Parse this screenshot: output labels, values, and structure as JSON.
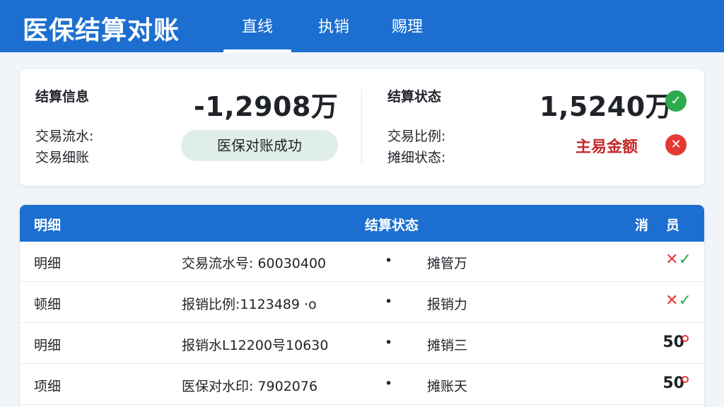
{
  "header": {
    "title": "医保结算对账",
    "tabs": [
      {
        "label": "直线",
        "active": true
      },
      {
        "label": "执销",
        "active": false
      },
      {
        "label": "赐理",
        "active": false
      }
    ]
  },
  "summary": {
    "left": {
      "heading": "结算信息",
      "amount": "-1,2908万",
      "line1": "交易流水:",
      "line2": "交易细账",
      "pill": "医保对账成功"
    },
    "right": {
      "heading": "结算状态",
      "amount": "1,5240万",
      "line1": "交易比例:",
      "line2": "摊细状态:",
      "alert": "主易金额"
    }
  },
  "table": {
    "headers": {
      "col1": "明细",
      "col2": "结算状态",
      "col3": "消",
      "col4": "员"
    },
    "rows": [
      {
        "name": "明细",
        "detail": "交易流水号: 60030400",
        "dot": "•",
        "status": "摊管万",
        "marks": [
          "✕",
          "✓"
        ],
        "value": ""
      },
      {
        "name": "顿细",
        "detail": "报销比例:1123489 ·o",
        "dot": "•",
        "status": "报销力",
        "marks": [
          "✕",
          "✓"
        ],
        "value": ""
      },
      {
        "name": "明细",
        "detail": "报销水L12200号10630",
        "dot": "•",
        "status": "摊销三",
        "marks": [],
        "value": "50"
      },
      {
        "name": "项细",
        "detail": "医保对水印: 7902076",
        "dot": "•",
        "status": "摊账天",
        "marks": [],
        "value": "50"
      }
    ]
  },
  "colors": {
    "primary": "#1c6fd1",
    "success": "#2eaa4e",
    "danger": "#e53935",
    "background": "#f1f4f8"
  }
}
